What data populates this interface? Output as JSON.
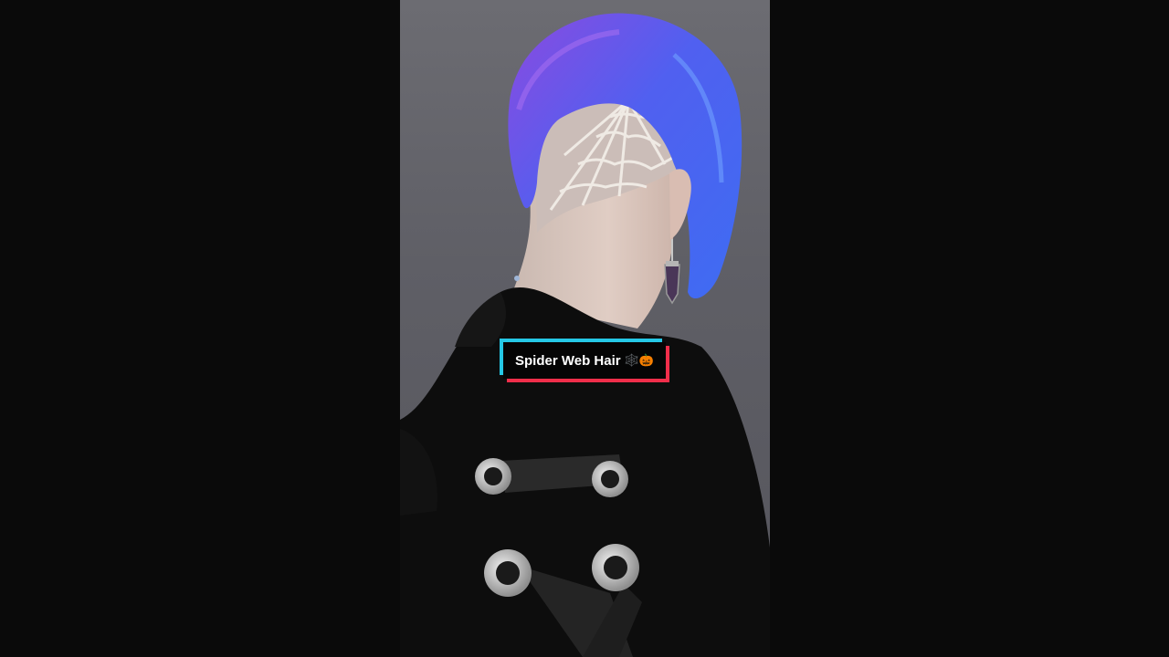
{
  "video": {
    "caption_text": "Spider Web Hair",
    "caption_emoji": "🕸️🎃",
    "colors": {
      "background": "#0a0a0a",
      "backdrop": "#62626a",
      "hair_blue": "#4f5ff0",
      "hair_purple": "#7a3fd8",
      "caption_cyan": "#25c8e6",
      "caption_red": "#f02e4a",
      "caption_box": "#050505"
    }
  }
}
